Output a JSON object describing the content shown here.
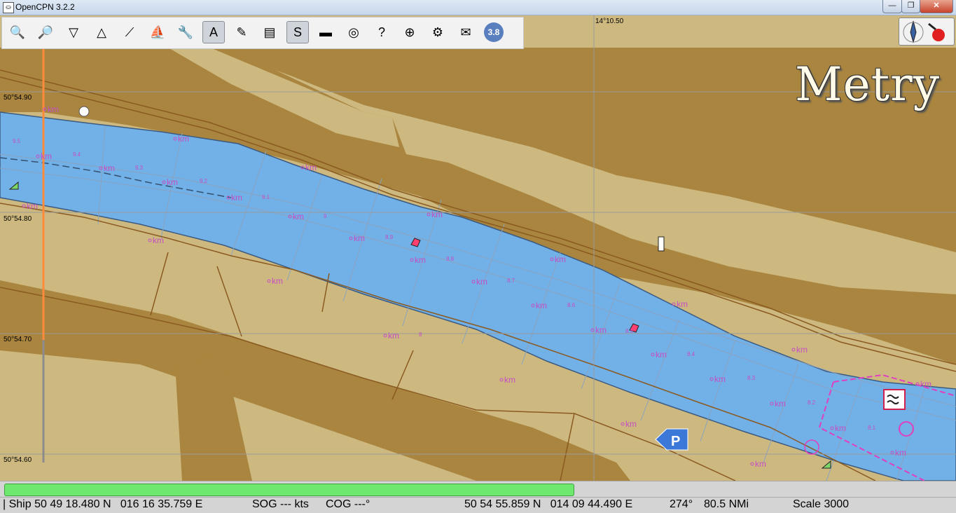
{
  "window": {
    "title": "OpenCPN 3.2.2",
    "minimize": "—",
    "maximize": "❐",
    "close": "✕"
  },
  "toolbar": {
    "buttons": [
      {
        "name": "zoom-in-button",
        "icon": "zoom-in-icon",
        "glyph": "🔍"
      },
      {
        "name": "zoom-out-button",
        "icon": "zoom-out-icon",
        "glyph": "🔎"
      },
      {
        "name": "scale-down-button",
        "icon": "chart-scale-down-icon",
        "glyph": "▽"
      },
      {
        "name": "scale-up-button",
        "icon": "chart-scale-up-icon",
        "glyph": "△"
      },
      {
        "name": "route-button",
        "icon": "route-icon",
        "glyph": "⟋"
      },
      {
        "name": "auto-follow-button",
        "icon": "boat-icon",
        "glyph": "⛵"
      },
      {
        "name": "settings-button",
        "icon": "wrench-icon",
        "glyph": "🔧"
      },
      {
        "name": "text-toggle-button",
        "icon": "text-icon",
        "glyph": "A"
      },
      {
        "name": "current-tide-button",
        "icon": "tide-icon",
        "glyph": "✎"
      },
      {
        "name": "route-manager-button",
        "icon": "route-manager-icon",
        "glyph": "▤"
      },
      {
        "name": "track-button",
        "icon": "track-icon",
        "glyph": "S"
      },
      {
        "name": "color-scheme-button",
        "icon": "sunset-icon",
        "glyph": "▬"
      },
      {
        "name": "mob-button",
        "icon": "lifebuoy-icon",
        "glyph": "◎"
      },
      {
        "name": "help-button",
        "icon": "help-book-icon",
        "glyph": "?"
      },
      {
        "name": "radar-button",
        "icon": "radar-icon",
        "glyph": "⊕"
      },
      {
        "name": "plugin-button",
        "icon": "gears-icon",
        "glyph": "⚙"
      },
      {
        "name": "print-button",
        "icon": "print-chart-icon",
        "glyph": "✉"
      },
      {
        "name": "version-button",
        "icon": "version-badge-icon",
        "glyph": "3.8"
      }
    ]
  },
  "chart": {
    "longitude_label": "14°10.50",
    "latitudes": [
      "50°54.90",
      "50°54.80",
      "50°54.70",
      "50°54.60"
    ],
    "units_label": "Metry",
    "km_marker": "km",
    "km_numbers": [
      "9.5",
      "9.4",
      "9.3",
      "9.2",
      "9.1",
      "9",
      "8.9",
      "8.8",
      "8.7",
      "8.6",
      "8.5",
      "8.4",
      "8.3",
      "8.2",
      "8.1",
      "8"
    ],
    "parking_symbol": "P"
  },
  "progress": {
    "fraction": 0.595
  },
  "status": {
    "ship": "| Ship 50 49 18.480 N   016 16 35.759 E",
    "sog": "SOG --- kts",
    "cog": "COG ---°",
    "cursor": "50 54 55.859 N   014 09 44.490 E",
    "bearing": "274°",
    "range": "80.5 NMi",
    "scale": "Scale 3000"
  },
  "colors": {
    "water": "#72b0e8",
    "land": "#cdb97f",
    "dry": "#a9853f",
    "km": "#c44ec4"
  }
}
